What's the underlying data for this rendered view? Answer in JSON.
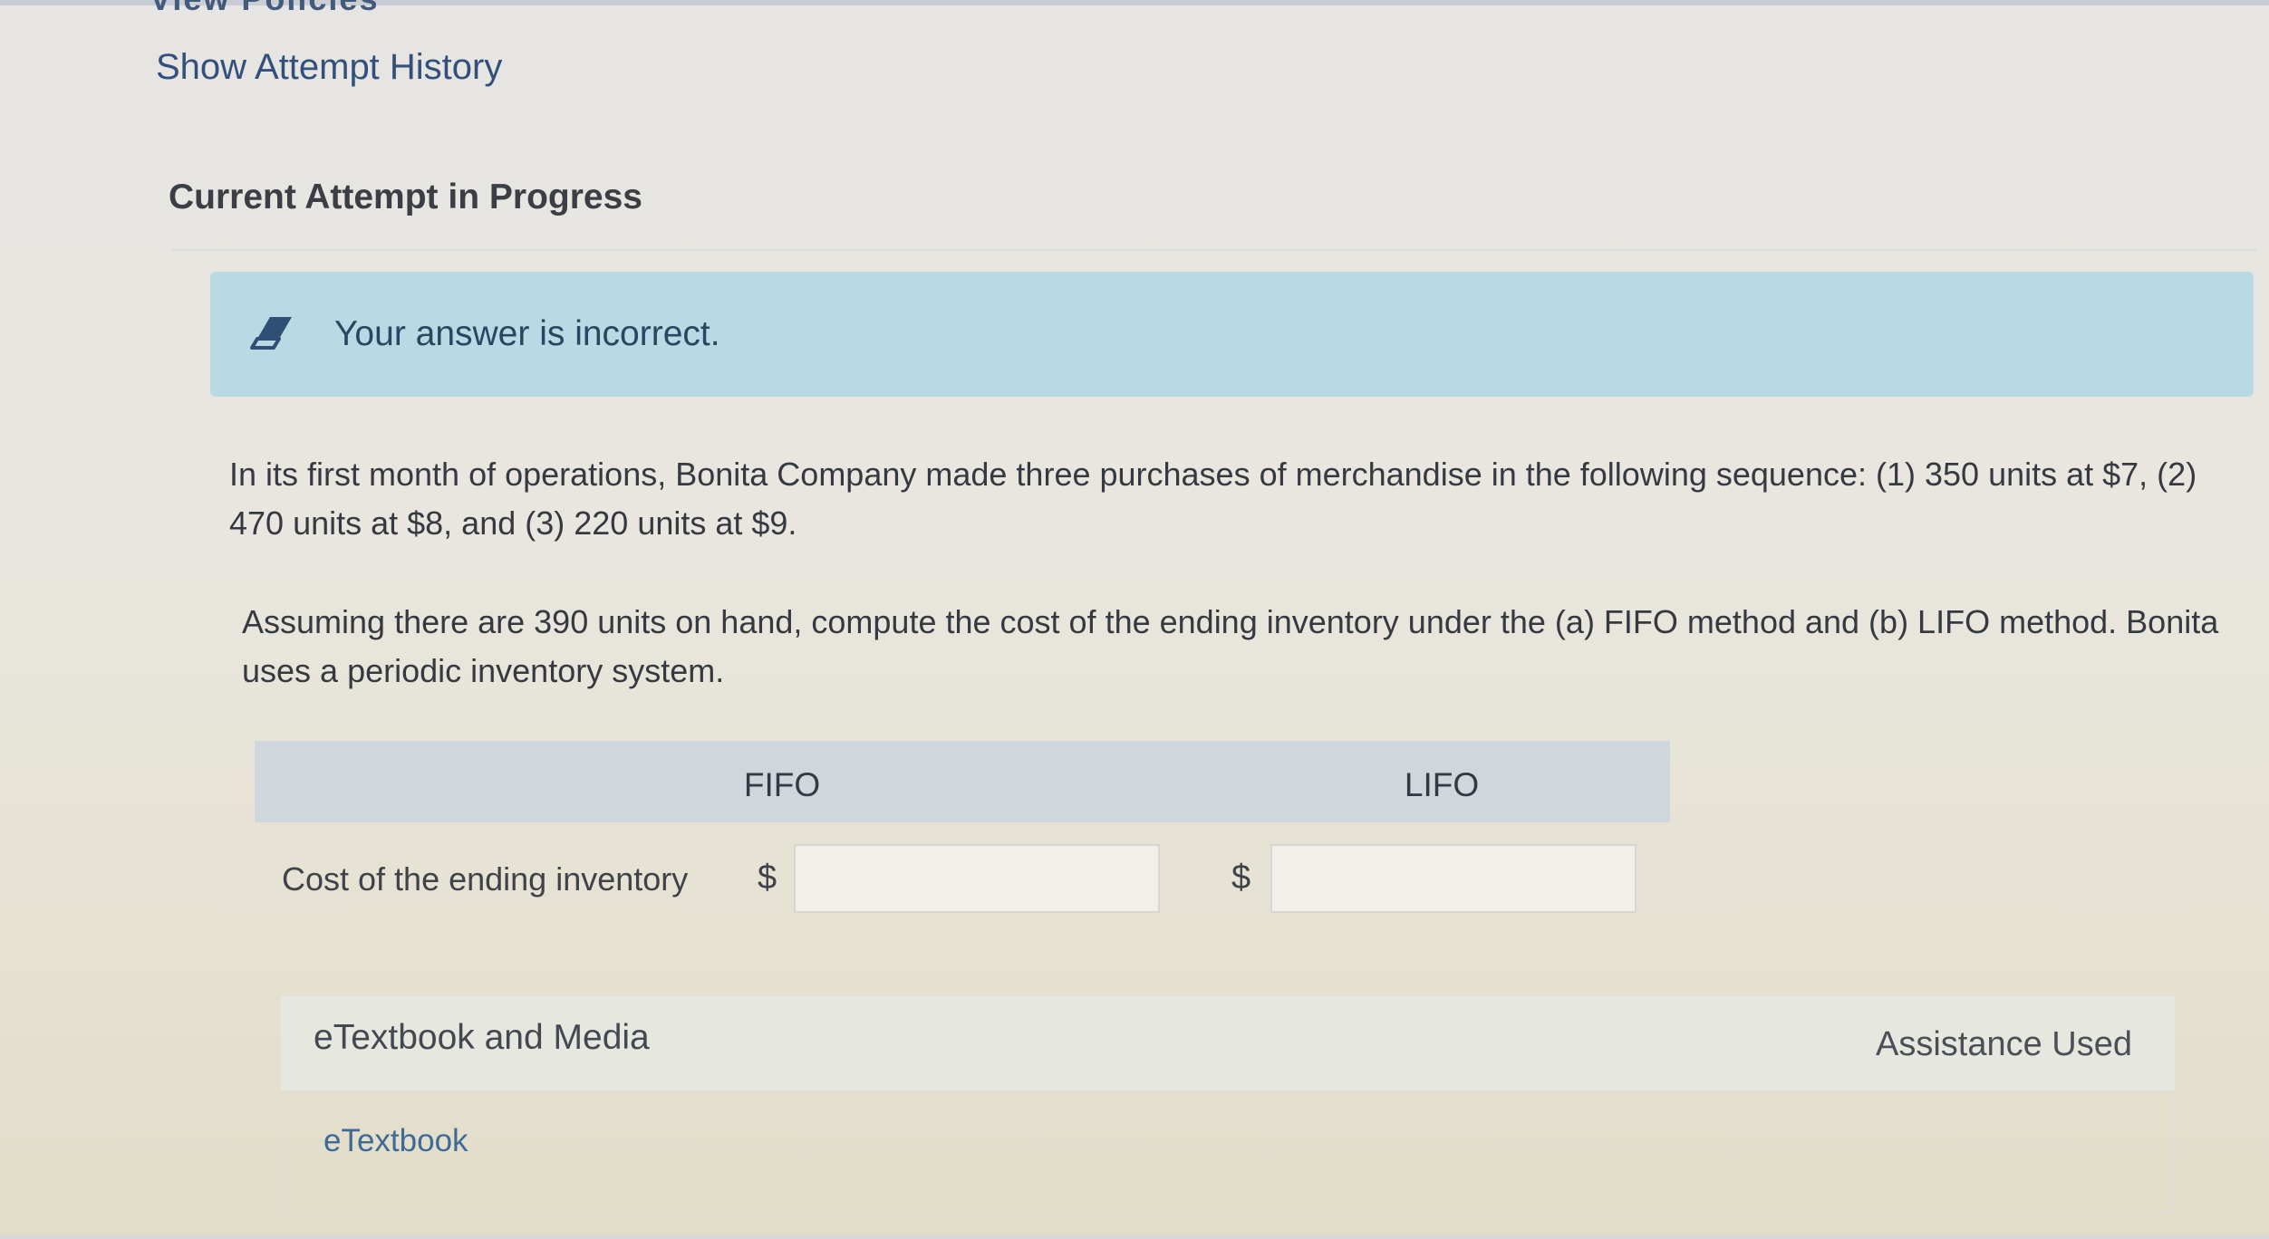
{
  "header": {
    "cut_text": "View Policies",
    "attempt_history_link": "Show Attempt History",
    "section_title": "Current Attempt in Progress"
  },
  "alert": {
    "icon": "eraser-icon",
    "message": "Your answer is incorrect."
  },
  "question": {
    "paragraph1": "In its first month of operations, Bonita Company made three purchases of merchandise in the following sequence: (1) 350 units at $7, (2) 470 units at $8, and (3) 220 units at $9.",
    "paragraph2": "Assuming there are 390 units on hand, compute the cost of the ending inventory under the (a) FIFO method and (b) LIFO method. Bonita uses a periodic inventory system."
  },
  "table": {
    "columns": [
      "",
      "FIFO",
      "LIFO"
    ],
    "row_label": "Cost of the ending inventory",
    "currency_symbol": "$",
    "fifo_value": "",
    "lifo_value": ""
  },
  "media": {
    "title": "eTextbook and Media",
    "assistance": "Assistance Used",
    "link": "eTextbook"
  }
}
